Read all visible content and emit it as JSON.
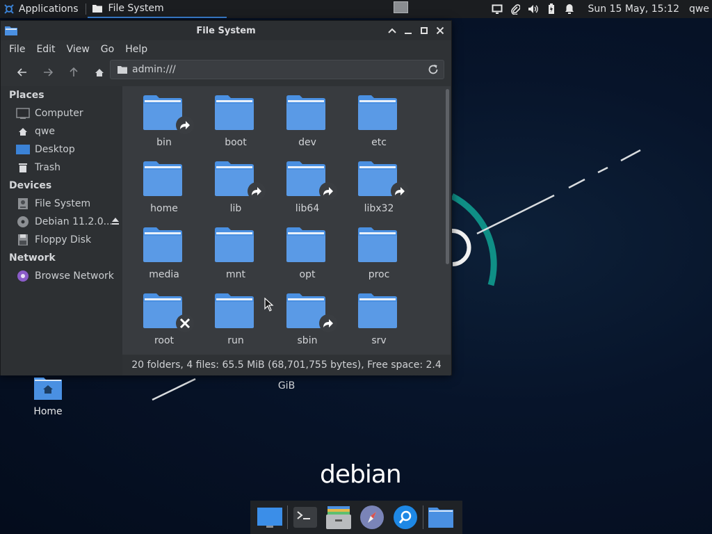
{
  "top_panel": {
    "applications_label": "Applications",
    "task_title": "File System",
    "clock": "Sun 15 May, 15:12",
    "user": "qwe",
    "tray_icons": [
      "display-icon",
      "paperclip-icon",
      "volume-icon",
      "battery-icon",
      "bell-icon"
    ]
  },
  "window": {
    "title": "File System",
    "menu": [
      "File",
      "Edit",
      "View",
      "Go",
      "Help"
    ],
    "location": "admin:///",
    "sidebar": {
      "places_header": "Places",
      "places": [
        "Computer",
        "qwe",
        "Desktop",
        "Trash"
      ],
      "devices_header": "Devices",
      "devices": [
        "File System",
        "Debian 11.2.0...",
        "Floppy Disk"
      ],
      "network_header": "Network",
      "network": [
        "Browse Network"
      ]
    },
    "folders": [
      {
        "name": "bin",
        "emblem": "symlink"
      },
      {
        "name": "boot",
        "emblem": ""
      },
      {
        "name": "dev",
        "emblem": ""
      },
      {
        "name": "etc",
        "emblem": ""
      },
      {
        "name": "home",
        "emblem": ""
      },
      {
        "name": "lib",
        "emblem": "symlink"
      },
      {
        "name": "lib64",
        "emblem": "symlink"
      },
      {
        "name": "libx32",
        "emblem": "symlink"
      },
      {
        "name": "media",
        "emblem": ""
      },
      {
        "name": "mnt",
        "emblem": ""
      },
      {
        "name": "opt",
        "emblem": ""
      },
      {
        "name": "proc",
        "emblem": ""
      },
      {
        "name": "root",
        "emblem": "unreadable"
      },
      {
        "name": "run",
        "emblem": ""
      },
      {
        "name": "sbin",
        "emblem": "symlink"
      },
      {
        "name": "srv",
        "emblem": ""
      }
    ],
    "status": "20 folders, 4 files: 65.5 MiB (68,701,755 bytes), Free space: 2.4 GiB"
  },
  "desktop": {
    "home_icon_label": "Home",
    "logo_text": "debian"
  },
  "dock": [
    "desktop-icon",
    "terminal-icon",
    "file-manager-icon",
    "web-browser-icon",
    "app-finder-icon",
    "folder-icon"
  ],
  "colors": {
    "folder_blue": "#4a90e2",
    "accent": "#3b82d6",
    "teal_arc": "#1aa39a"
  }
}
